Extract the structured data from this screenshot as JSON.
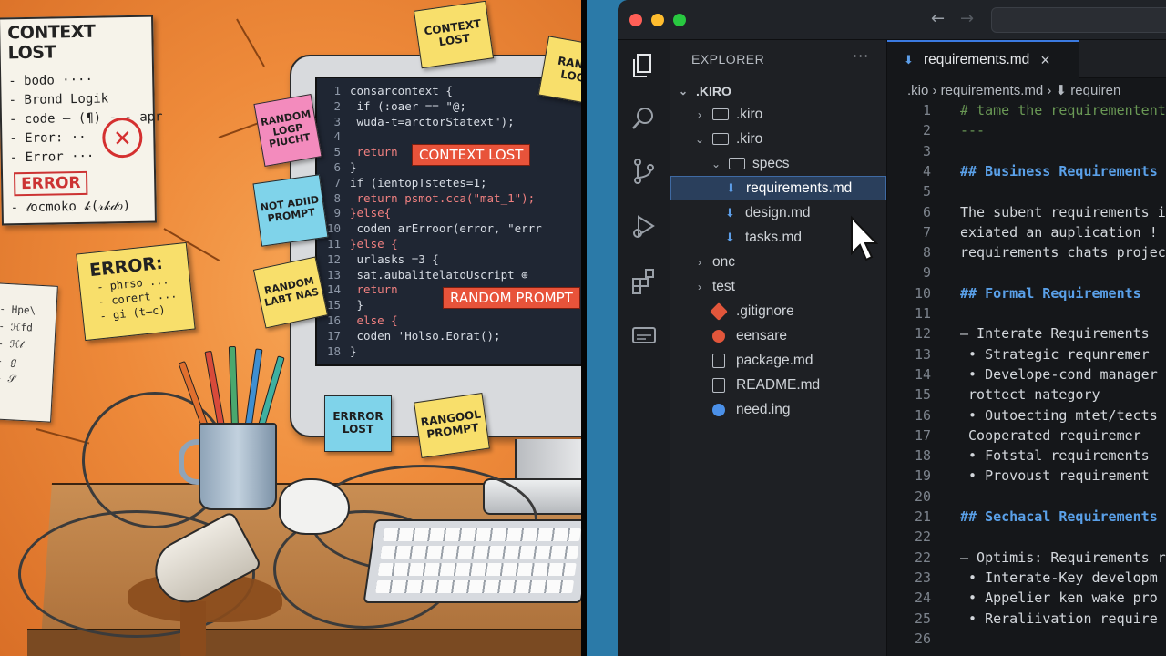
{
  "illustration": {
    "paper_main": {
      "title": "CONTEXT LOST",
      "lines": [
        "- bodo ····",
        "- Brond Logik",
        "- code – (¶) - - apr",
        "- Eror: ··",
        "- Error ···"
      ],
      "error_label": "ERROR",
      "scribble": "- 𝓉ocmoko  𝓀(𝓇𝓀𝒹𝑜)"
    },
    "paper_left": {
      "lines": [
        "- Hpe\\",
        "- ℋfd",
        "- ℋ𝓁",
        "- ℊ",
        "- 𝒮"
      ]
    },
    "error_note": {
      "title": "ERROR:",
      "lines": [
        "- phrso ...",
        "- corert ...",
        "- gi (t̶c)"
      ]
    },
    "notes": {
      "top_context": "CONTEXT LOST",
      "top_right": "RANG LOG",
      "pink": "RANDOM LOGP PIUCHT",
      "blue_left": "NOT ADIID PROMPT",
      "yellow_mid": "RANDOM LABT NAS",
      "bottom_blue": "ERRROR LOST",
      "bottom_yellow": "RANGOOL PROMPT"
    },
    "screen_code": [
      {
        "n": "1",
        "t": "consarcontext {"
      },
      {
        "n": "2",
        "t": " if (:oaer == \"@;"
      },
      {
        "n": "3",
        "t": "   wuda-t=arctorStatext\");"
      },
      {
        "n": "4",
        "t": ""
      },
      {
        "n": "5",
        "t": " return"
      },
      {
        "n": "6",
        "t": "}"
      },
      {
        "n": "7",
        "t": "if (ientopTstetes=1;"
      },
      {
        "n": "8",
        "t": "   return psmot.cca(\"mat_1\");"
      },
      {
        "n": "9",
        "t": "}else{"
      },
      {
        "n": "10",
        "t": "   coden arErroor(error, \"errr"
      },
      {
        "n": "11",
        "t": "}else {"
      },
      {
        "n": "12",
        "t": "   urlasks =3 {"
      },
      {
        "n": "13",
        "t": "     sat.aubalitelatoUscript ⊕"
      },
      {
        "n": "14",
        "t": "     return"
      },
      {
        "n": "15",
        "t": "   }"
      },
      {
        "n": "16",
        "t": "   else {"
      },
      {
        "n": "17",
        "t": "   coden 'Holso.Eorat();"
      },
      {
        "n": "18",
        "t": "}"
      }
    ],
    "screen_labels": {
      "context_lost": "CONTEXT LOST",
      "random_prompt": "RANDOM PROMPT"
    },
    "apple_glyph": ""
  },
  "ide": {
    "nav": {
      "back": "←",
      "forward": "→"
    },
    "activity_icons": [
      "files-icon",
      "search-icon",
      "source-control-icon",
      "run-debug-icon",
      "extensions-icon",
      "remote-icon"
    ],
    "explorer": {
      "title": "EXPLORER",
      "more": "···",
      "root": ".KIRO",
      "items": [
        {
          "label": ".kiro",
          "indent": 1,
          "type": "folder",
          "chev": "›"
        },
        {
          "label": ".kiro",
          "indent": 1,
          "type": "folder",
          "chev": "⌄"
        },
        {
          "label": "specs",
          "indent": 2,
          "type": "folder",
          "chev": "⌄"
        },
        {
          "label": "requirements.md",
          "indent": 3,
          "type": "md",
          "selected": true
        },
        {
          "label": "design.md",
          "indent": 3,
          "type": "md"
        },
        {
          "label": "tasks.md",
          "indent": 3,
          "type": "md"
        },
        {
          "label": "onc",
          "indent": 1,
          "type": "folder-plain",
          "chev": "›"
        },
        {
          "label": "test",
          "indent": 1,
          "type": "folder-plain",
          "chev": "›"
        },
        {
          "label": ".gitignore",
          "indent": 1,
          "type": "git"
        },
        {
          "label": "eensare",
          "indent": 1,
          "type": "red"
        },
        {
          "label": "package.md",
          "indent": 1,
          "type": "grey"
        },
        {
          "label": "README.md",
          "indent": 1,
          "type": "grey"
        },
        {
          "label": "need.ing",
          "indent": 1,
          "type": "blue"
        }
      ]
    },
    "tab": {
      "label": "requirements.md",
      "close": "×"
    },
    "breadcrumb": ".kio  ›  requirements.md  ›  ⬇ requiren",
    "code_lines": [
      {
        "n": "1",
        "t": "# tame the requirementent",
        "k": "cm"
      },
      {
        "n": "2",
        "t": "---",
        "k": "cm"
      },
      {
        "n": "3",
        "t": "",
        "k": ""
      },
      {
        "n": "4",
        "t": "## Business Requirements",
        "k": "hd"
      },
      {
        "n": "5",
        "t": "",
        "k": ""
      },
      {
        "n": "6",
        "t": "The subent requirements i",
        "k": ""
      },
      {
        "n": "7",
        "t": "exiated an auplication !",
        "k": ""
      },
      {
        "n": "8",
        "t": "requirements chats projec",
        "k": ""
      },
      {
        "n": "9",
        "t": "",
        "k": ""
      },
      {
        "n": "10",
        "t": "## Formal Requirements",
        "k": "hd"
      },
      {
        "n": "11",
        "t": "",
        "k": ""
      },
      {
        "n": "12",
        "t": "– Interate Requirements",
        "k": ""
      },
      {
        "n": "13",
        "t": "  • Strategic requnremer",
        "k": ""
      },
      {
        "n": "14",
        "t": "  • Develope-cond manager",
        "k": ""
      },
      {
        "n": "15",
        "t": "    rottect nategory",
        "k": ""
      },
      {
        "n": "16",
        "t": "  • Outoecting mtet/tects",
        "k": ""
      },
      {
        "n": "17",
        "t": "    Cooperated requiremer",
        "k": ""
      },
      {
        "n": "18",
        "t": "  • Fotstal requirements",
        "k": ""
      },
      {
        "n": "19",
        "t": "  • Provoust requirement",
        "k": ""
      },
      {
        "n": "20",
        "t": "",
        "k": ""
      },
      {
        "n": "21",
        "t": "## Sechacal Requirements",
        "k": "hd"
      },
      {
        "n": "22",
        "t": "",
        "k": ""
      },
      {
        "n": "22",
        "t": "– Optimis: Requirements r",
        "k": ""
      },
      {
        "n": "23",
        "t": "  • Interate-Key developm",
        "k": ""
      },
      {
        "n": "24",
        "t": "  • Appelier ken wake pro",
        "k": ""
      },
      {
        "n": "25",
        "t": "  • Reraliivation require",
        "k": ""
      },
      {
        "n": "26",
        "t": "",
        "k": ""
      }
    ]
  },
  "colors": {
    "wall": "#ee8a3a",
    "sticky_yellow": "#f8df6b",
    "sticky_pink": "#f38bbd",
    "sticky_blue": "#7fd3ea",
    "error_red": "#e8533a",
    "ide_bg": "#15171a",
    "ide_accent": "#3b7ae0",
    "heading_blue": "#5aa0e8",
    "traffic_red": "#ff5f57",
    "traffic_yellow": "#febc2e",
    "traffic_green": "#28c840"
  }
}
